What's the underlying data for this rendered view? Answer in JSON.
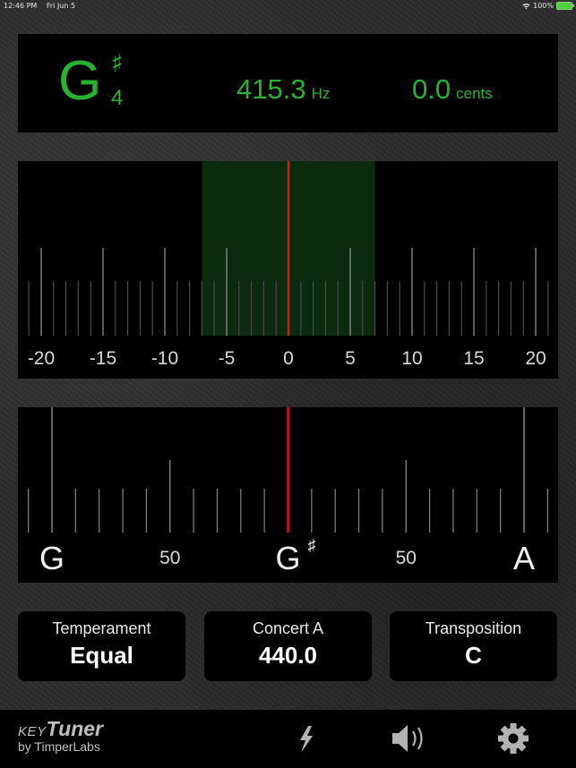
{
  "status_bar": {
    "time": "12:46 PM",
    "date": "Fri Jun 5",
    "battery_percent": "100%",
    "icons": [
      "wifi-icon",
      "battery-charging-icon"
    ]
  },
  "display": {
    "note_letter": "G",
    "note_accidental": "♯",
    "note_octave": "4",
    "frequency_value": "415.3",
    "frequency_unit": "Hz",
    "cents_value": "0.0",
    "cents_unit": "cents",
    "color": "#27b330"
  },
  "cents_meter": {
    "min": -20,
    "max": 20,
    "minor_step": 1,
    "major_step": 5,
    "labels": [
      "-20",
      "-15",
      "-10",
      "-5",
      "0",
      "5",
      "10",
      "15",
      "20"
    ],
    "in_tune_zone": [
      -7,
      7
    ],
    "needle_value": 0,
    "zone_color": "#0c2a0e",
    "needle_color": "#c0281c"
  },
  "note_meter": {
    "min_cents": -100,
    "max_cents": 100,
    "minor_step": 10,
    "labels": [
      {
        "text": "G",
        "cents": -100,
        "accidental": ""
      },
      {
        "text": "50",
        "cents": -50,
        "accidental": ""
      },
      {
        "text": "G",
        "cents": 0,
        "accidental": "♯"
      },
      {
        "text": "50",
        "cents": 50,
        "accidental": ""
      },
      {
        "text": "A",
        "cents": 100,
        "accidental": ""
      }
    ],
    "needle_cents": 0,
    "needle_color": "#e01010"
  },
  "settings": [
    {
      "label": "Temperament",
      "value": "Equal"
    },
    {
      "label": "Concert A",
      "value": "440.0"
    },
    {
      "label": "Transposition",
      "value": "C"
    }
  ],
  "bottom_bar": {
    "brand_key": "KEY",
    "brand_tuner": "Tuner",
    "brand_by": "by TimperLabs",
    "icons": [
      "lightning-icon",
      "speaker-icon",
      "gear-icon"
    ]
  }
}
